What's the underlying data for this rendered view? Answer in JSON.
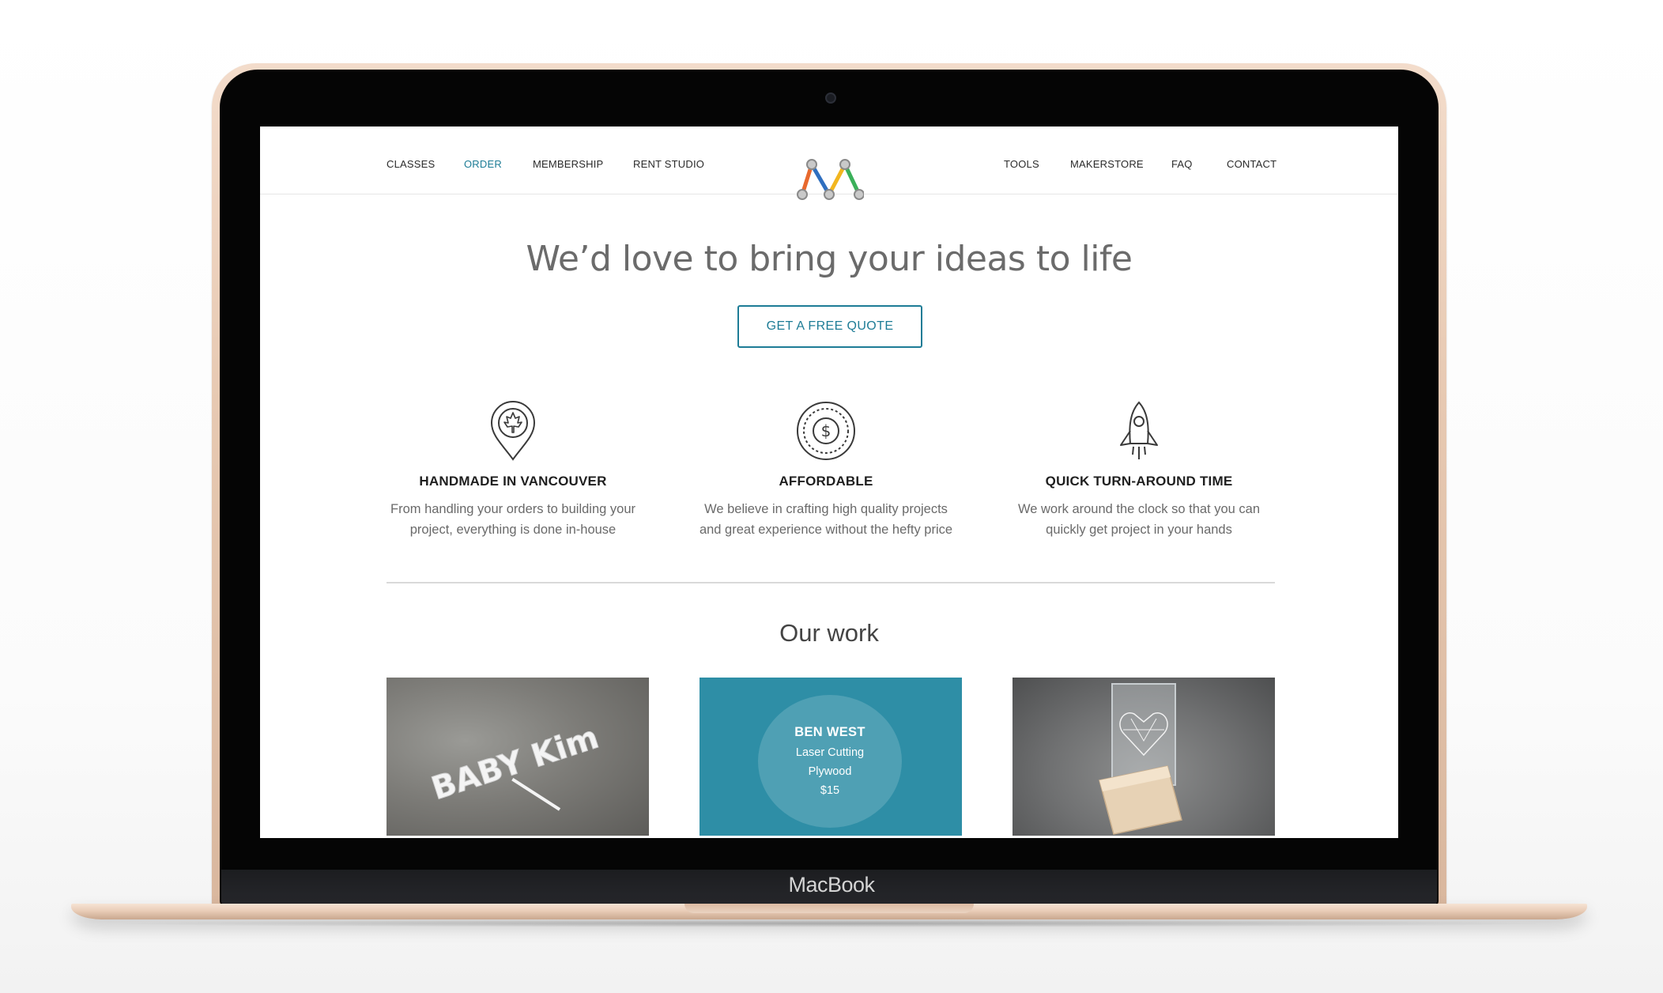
{
  "device": {
    "brand_label": "MacBook"
  },
  "nav": {
    "left": [
      "CLASSES",
      "ORDER",
      "MEMBERSHIP",
      "RENT STUDIO"
    ],
    "right": [
      "TOOLS",
      "MAKERSTORE",
      "FAQ",
      "CONTACT"
    ],
    "active": "ORDER",
    "accent_color": "#1d7c96"
  },
  "hero": {
    "title": "We’d love to bring your ideas to life",
    "cta_label": "GET A FREE QUOTE"
  },
  "features": [
    {
      "icon": "map-pin-maple-leaf-icon",
      "title": "HANDMADE IN VANCOUVER",
      "line1": "From handling your orders to building your",
      "line2": "project, everything is done in-house"
    },
    {
      "icon": "dollar-coin-icon",
      "title": "AFFORDABLE",
      "line1": "We believe in crafting high quality projects",
      "line2": "and great experience without the hefty price"
    },
    {
      "icon": "rocket-icon",
      "title": "QUICK TURN-AROUND TIME",
      "line1": "We work around the clock so that you can",
      "line2": "quickly get project in your hands"
    }
  ],
  "work": {
    "title": "Our work",
    "tiles": [
      {
        "image": "white-acrylic-baby-name-cake-topper-photo",
        "sign_text": "BABY Kim"
      },
      {
        "image": "laser-cut-plywood-project-photo",
        "name": "BEN WEST",
        "service": "Laser Cutting",
        "material": "Plywood",
        "price": "$15",
        "overlay_color": "#2e8ea6"
      },
      {
        "image": "engraved-acrylic-heart-on-wood-base-photo"
      }
    ]
  }
}
